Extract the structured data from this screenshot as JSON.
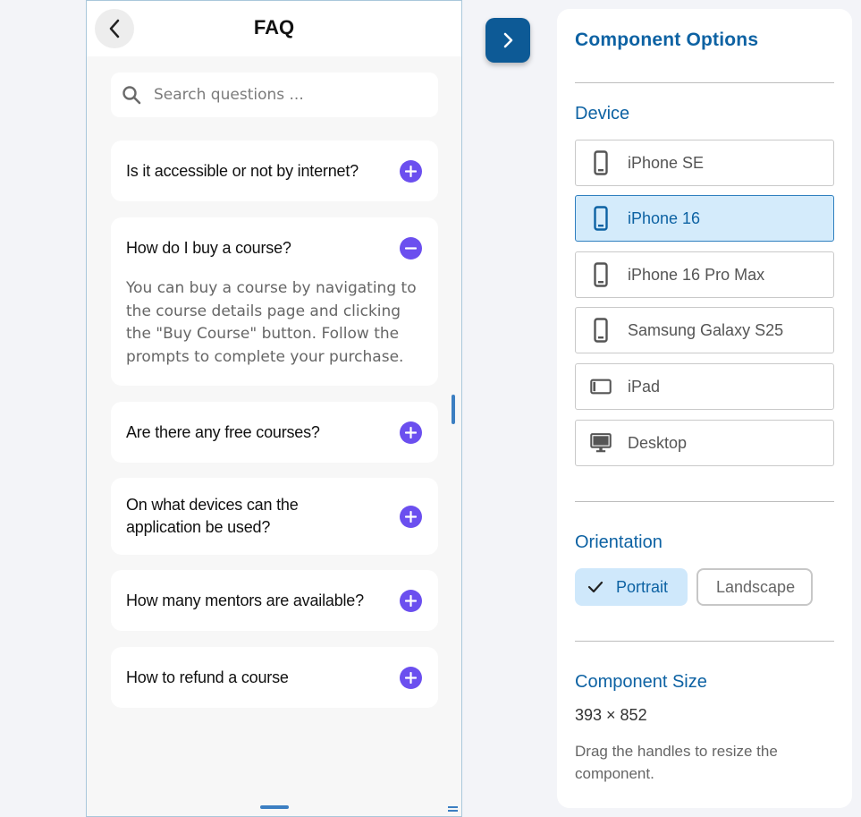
{
  "faq": {
    "title": "FAQ",
    "search_placeholder": "Search questions ...",
    "items": [
      {
        "question": "Is it accessible or not by internet?",
        "expanded": false
      },
      {
        "question": "How do I buy a course?",
        "expanded": true,
        "answer": "You can buy a course by navigating to the course details page and clicking the \"Buy Course\" button. Follow the prompts to complete your purchase."
      },
      {
        "question": "Are there any free courses?",
        "expanded": false
      },
      {
        "question": "On what devices can the application be used?",
        "expanded": false
      },
      {
        "question": "How many mentors are available?",
        "expanded": false
      },
      {
        "question": "How to refund a course",
        "expanded": false
      }
    ]
  },
  "panel": {
    "title": "Component Options",
    "device_section": "Device",
    "devices": [
      {
        "label": "iPhone SE",
        "icon": "phone-icon"
      },
      {
        "label": "iPhone 16",
        "icon": "phone-icon",
        "selected": true
      },
      {
        "label": "iPhone 16 Pro Max",
        "icon": "phone-icon"
      },
      {
        "label": "Samsung Galaxy S25",
        "icon": "phone-icon"
      },
      {
        "label": "iPad",
        "icon": "tablet-icon"
      },
      {
        "label": "Desktop",
        "icon": "desktop-icon"
      }
    ],
    "orientation_section": "Orientation",
    "orientation": {
      "portrait": "Portrait",
      "landscape": "Landscape",
      "selected": "Portrait"
    },
    "size_section": "Component Size",
    "size_value": "393 × 852",
    "help_text": "Drag the handles to resize the component."
  },
  "colors": {
    "accent": "#0d62a3",
    "toggle": "#6b4fef",
    "selected_bg": "#d4ebfb"
  }
}
